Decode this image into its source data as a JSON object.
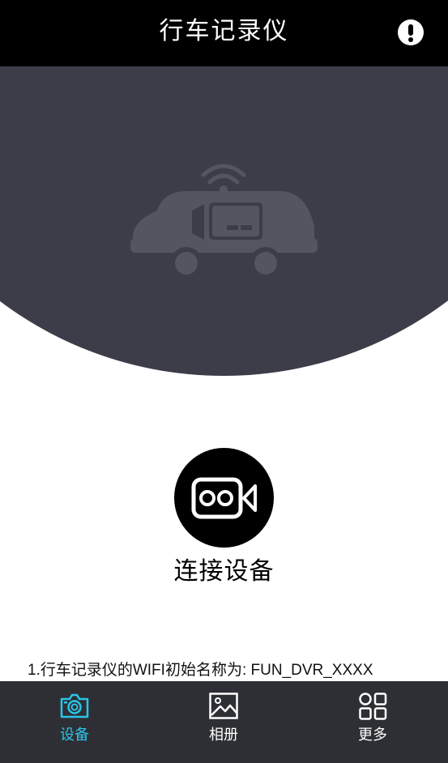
{
  "header": {
    "title": "行车记录仪",
    "info_icon": "exclamation-circle-icon"
  },
  "hero": {
    "illustration": "car-dvr-wifi-icon",
    "bg_color": "#3d3d4a"
  },
  "connect": {
    "icon": "video-camera-icon",
    "label": "连接设备"
  },
  "tip": {
    "text": "1.行车记录仪的WIFI初始名称为: FUN_DVR_XXXX"
  },
  "tabbar": {
    "active_color": "#2bc5e8",
    "tabs": [
      {
        "label": "设备",
        "icon": "camera-icon",
        "active": true
      },
      {
        "label": "相册",
        "icon": "image-icon",
        "active": false
      },
      {
        "label": "更多",
        "icon": "grid-icon",
        "active": false
      }
    ]
  }
}
